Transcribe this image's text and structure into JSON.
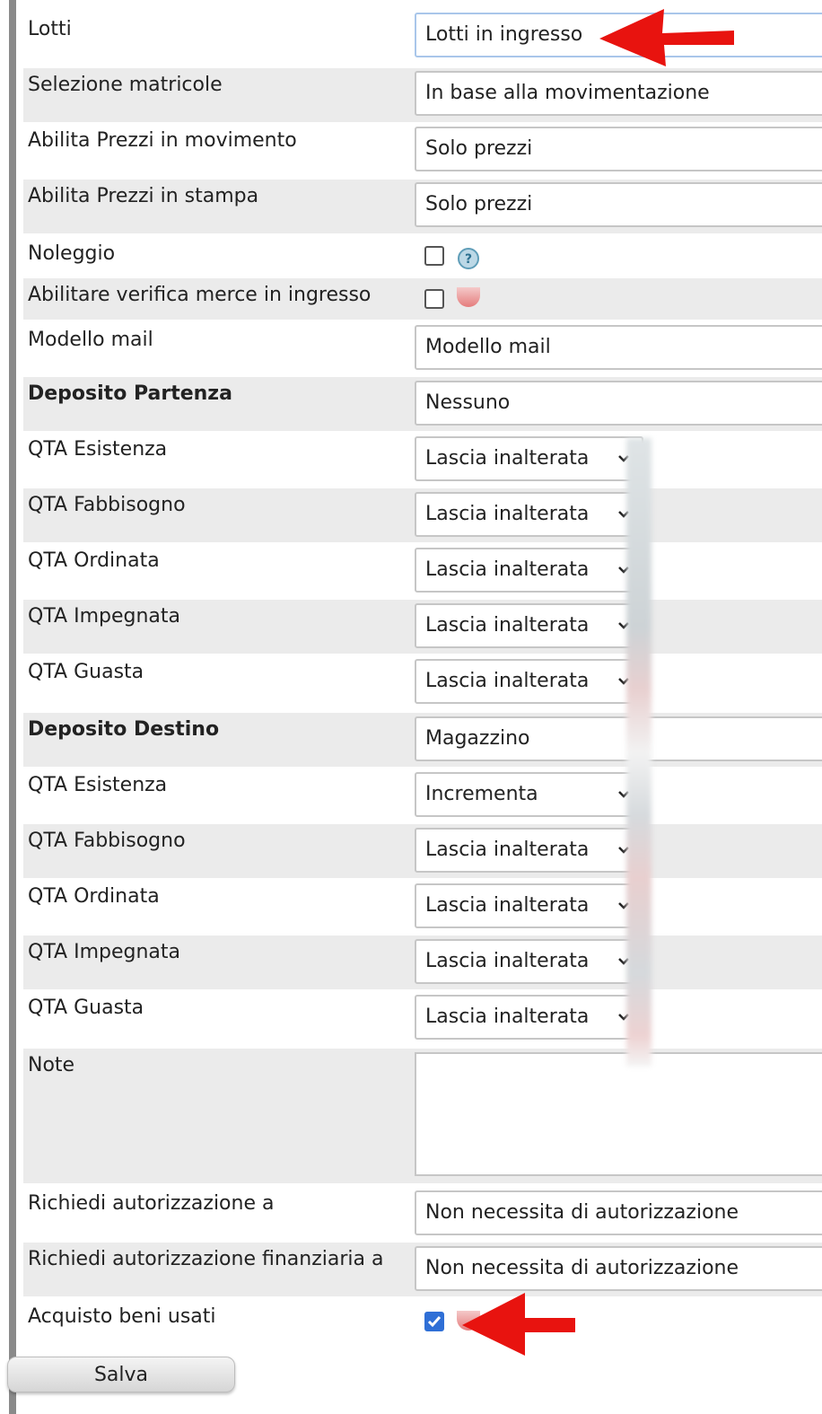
{
  "fields": {
    "lotti": {
      "label": "Lotti",
      "value": "Lotti in ingresso"
    },
    "selezione_matricole": {
      "label": "Selezione matricole",
      "value": "In base alla movimentazione"
    },
    "prezzi_movimento": {
      "label": "Abilita Prezzi in movimento",
      "value": "Solo prezzi"
    },
    "prezzi_stampa": {
      "label": "Abilita Prezzi in stampa",
      "value": "Solo prezzi"
    },
    "noleggio": {
      "label": "Noleggio",
      "checked": false,
      "help_icon": "question-icon"
    },
    "verifica_merce": {
      "label": "Abilitare verifica merce in ingresso",
      "checked": false
    },
    "modello_mail": {
      "label": "Modello mail",
      "value": "Modello mail"
    },
    "deposito_partenza": {
      "label": "Deposito Partenza",
      "value": "Nessuno"
    },
    "deposito_destino": {
      "label": "Deposito Destino",
      "value": "Magazzino"
    },
    "note": {
      "label": "Note",
      "value": ""
    },
    "autorizzazione": {
      "label": "Richiedi autorizzazione a",
      "value": "Non necessita di autorizzazione"
    },
    "autorizzazione_fin": {
      "label": "Richiedi autorizzazione finanziaria a",
      "value": "Non necessita di autorizzazione"
    },
    "beni_usati": {
      "label": "Acquisto beni usati",
      "checked": true
    }
  },
  "partenza": {
    "esistenza": {
      "label": "QTA Esistenza",
      "value": "Lascia inalterata"
    },
    "fabbisogno": {
      "label": "QTA Fabbisogno",
      "value": "Lascia inalterata"
    },
    "ordinata": {
      "label": "QTA Ordinata",
      "value": "Lascia inalterata"
    },
    "impegnata": {
      "label": "QTA Impegnata",
      "value": "Lascia inalterata"
    },
    "guasta": {
      "label": "QTA Guasta",
      "value": "Lascia inalterata"
    }
  },
  "destino": {
    "esistenza": {
      "label": "QTA Esistenza",
      "value": "Incrementa"
    },
    "fabbisogno": {
      "label": "QTA Fabbisogno",
      "value": "Lascia inalterata"
    },
    "ordinata": {
      "label": "QTA Ordinata",
      "value": "Lascia inalterata"
    },
    "impegnata": {
      "label": "QTA Impegnata",
      "value": "Lascia inalterata"
    },
    "guasta": {
      "label": "QTA Guasta",
      "value": "Lascia inalterata"
    }
  },
  "save_label": "Salva",
  "colors": {
    "row_shade": "#ebebeb",
    "arrow": "#e8130f",
    "checkbox_on": "#2f6fd6"
  }
}
